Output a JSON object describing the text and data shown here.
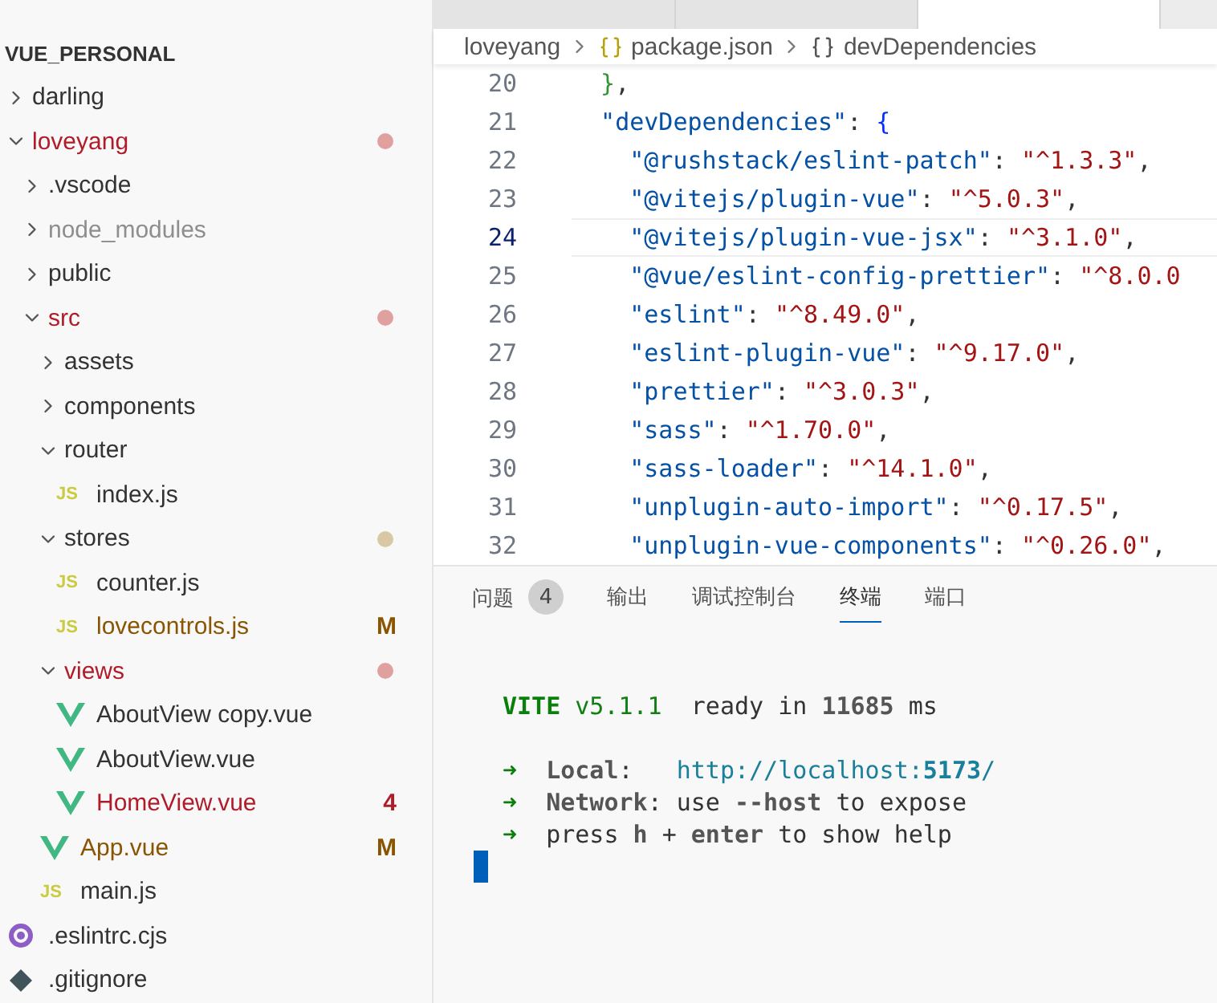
{
  "explorer": {
    "root": "VUE_PERSONAL",
    "items": [
      {
        "kind": "folder",
        "name": "darling",
        "expanded": false,
        "error": false,
        "modified": false,
        "ignored": false
      },
      {
        "kind": "folder",
        "name": "loveyang",
        "expanded": true,
        "error": true,
        "modified": false,
        "ignored": false,
        "color": "#e0a0a0",
        "children": [
          {
            "kind": "folder",
            "name": ".vscode",
            "expanded": false,
            "error": false,
            "modified": false,
            "ignored": false
          },
          {
            "kind": "folder",
            "name": "node_modules",
            "expanded": false,
            "error": false,
            "modified": false,
            "ignored": true
          },
          {
            "kind": "folder",
            "name": "public",
            "expanded": false,
            "error": false,
            "modified": false,
            "ignored": false
          },
          {
            "kind": "folder",
            "name": "src",
            "expanded": true,
            "error": true,
            "modified": false,
            "ignored": false,
            "color": "#e0a0a0",
            "children": [
              {
                "kind": "folder",
                "name": "assets",
                "expanded": false,
                "error": false,
                "modified": false,
                "ignored": false
              },
              {
                "kind": "folder",
                "name": "components",
                "expanded": false,
                "error": false,
                "modified": false,
                "ignored": false
              },
              {
                "kind": "folder",
                "name": "router",
                "expanded": true,
                "error": false,
                "modified": false,
                "ignored": false,
                "children": [
                  {
                    "kind": "js",
                    "icon_label": "JS",
                    "name": "index.js",
                    "error": false,
                    "modified": false,
                    "ignored": false
                  }
                ]
              },
              {
                "kind": "folder",
                "name": "stores",
                "expanded": true,
                "error": false,
                "modified": false,
                "ignored": false,
                "color": "#d8c8a8",
                "children": [
                  {
                    "kind": "js",
                    "icon_label": "JS",
                    "name": "counter.js",
                    "error": false,
                    "modified": false,
                    "ignored": false
                  },
                  {
                    "kind": "js",
                    "icon_label": "JS",
                    "name": "lovecontrols.js",
                    "error": false,
                    "modified": true,
                    "ignored": false,
                    "badge": "M"
                  }
                ]
              },
              {
                "kind": "folder",
                "name": "views",
                "expanded": true,
                "error": true,
                "modified": false,
                "ignored": false,
                "color": "#e0a0a0",
                "children": [
                  {
                    "kind": "vue",
                    "name": "AboutView copy.vue",
                    "error": false,
                    "modified": false,
                    "ignored": false
                  },
                  {
                    "kind": "vue",
                    "name": "AboutView.vue",
                    "error": false,
                    "modified": false,
                    "ignored": false
                  },
                  {
                    "kind": "vue",
                    "name": "HomeView.vue",
                    "error": true,
                    "modified": false,
                    "ignored": false,
                    "badge": "4"
                  }
                ]
              },
              {
                "kind": "vue",
                "name": "App.vue",
                "error": false,
                "modified": true,
                "ignored": false,
                "badge": "M"
              },
              {
                "kind": "js",
                "icon_label": "JS",
                "name": "main.js",
                "error": false,
                "modified": false,
                "ignored": false
              }
            ]
          }
        ]
      },
      {
        "kind": "eslint",
        "name": ".eslintrc.cjs",
        "error": false,
        "modified": false,
        "ignored": false
      },
      {
        "kind": "git",
        "name": ".gitignore",
        "error": false,
        "modified": false,
        "ignored": false
      }
    ]
  },
  "editor": {
    "open_tabs": [
      {
        "selected": false
      },
      {
        "selected": false
      },
      {
        "selected": true
      }
    ],
    "breadcrumb": [
      {
        "kind": "folder",
        "label": "loveyang"
      },
      {
        "kind": "json",
        "label": "package.json"
      },
      {
        "kind": "object",
        "label": "devDependencies"
      }
    ],
    "lines": [
      {
        "number": "20",
        "current": false,
        "tokens": [
          {
            "kind": "bracket2",
            "text": "  }"
          },
          {
            "kind": "punct",
            "text": ","
          }
        ]
      },
      {
        "number": "21",
        "current": false,
        "tokens": [
          {
            "kind": "key",
            "text": "  \"devDependencies\""
          },
          {
            "kind": "punct",
            "text": ": "
          },
          {
            "kind": "bracket1",
            "text": "{"
          }
        ]
      },
      {
        "number": "22",
        "current": false,
        "tokens": [
          {
            "kind": "key",
            "text": "    \"@rushstack/eslint-patch\""
          },
          {
            "kind": "punct",
            "text": ": "
          },
          {
            "kind": "string",
            "text": "\"^1.3.3\""
          },
          {
            "kind": "punct",
            "text": ","
          }
        ]
      },
      {
        "number": "23",
        "current": false,
        "tokens": [
          {
            "kind": "key",
            "text": "    \"@vitejs/plugin-vue\""
          },
          {
            "kind": "punct",
            "text": ": "
          },
          {
            "kind": "string",
            "text": "\"^5.0.3\""
          },
          {
            "kind": "punct",
            "text": ","
          }
        ]
      },
      {
        "number": "24",
        "current": true,
        "tokens": [
          {
            "kind": "key",
            "text": "    \"@vitejs/plugin-vue-jsx\""
          },
          {
            "kind": "punct",
            "text": ": "
          },
          {
            "kind": "string",
            "text": "\"^3.1.0\""
          },
          {
            "kind": "punct",
            "text": ","
          }
        ]
      },
      {
        "number": "25",
        "current": false,
        "tokens": [
          {
            "kind": "key",
            "text": "    \"@vue/eslint-config-prettier\""
          },
          {
            "kind": "punct",
            "text": ": "
          },
          {
            "kind": "string",
            "text": "\"^8.0.0"
          }
        ]
      },
      {
        "number": "26",
        "current": false,
        "tokens": [
          {
            "kind": "key",
            "text": "    \"eslint\""
          },
          {
            "kind": "punct",
            "text": ": "
          },
          {
            "kind": "string",
            "text": "\"^8.49.0\""
          },
          {
            "kind": "punct",
            "text": ","
          }
        ]
      },
      {
        "number": "27",
        "current": false,
        "tokens": [
          {
            "kind": "key",
            "text": "    \"eslint-plugin-vue\""
          },
          {
            "kind": "punct",
            "text": ": "
          },
          {
            "kind": "string",
            "text": "\"^9.17.0\""
          },
          {
            "kind": "punct",
            "text": ","
          }
        ]
      },
      {
        "number": "28",
        "current": false,
        "tokens": [
          {
            "kind": "key",
            "text": "    \"prettier\""
          },
          {
            "kind": "punct",
            "text": ": "
          },
          {
            "kind": "string",
            "text": "\"^3.0.3\""
          },
          {
            "kind": "punct",
            "text": ","
          }
        ]
      },
      {
        "number": "29",
        "current": false,
        "tokens": [
          {
            "kind": "key",
            "text": "    \"sass\""
          },
          {
            "kind": "punct",
            "text": ": "
          },
          {
            "kind": "string",
            "text": "\"^1.70.0\""
          },
          {
            "kind": "punct",
            "text": ","
          }
        ]
      },
      {
        "number": "30",
        "current": false,
        "tokens": [
          {
            "kind": "key",
            "text": "    \"sass-loader\""
          },
          {
            "kind": "punct",
            "text": ": "
          },
          {
            "kind": "string",
            "text": "\"^14.1.0\""
          },
          {
            "kind": "punct",
            "text": ","
          }
        ]
      },
      {
        "number": "31",
        "current": false,
        "tokens": [
          {
            "kind": "key",
            "text": "    \"unplugin-auto-import\""
          },
          {
            "kind": "punct",
            "text": ": "
          },
          {
            "kind": "string",
            "text": "\"^0.17.5\""
          },
          {
            "kind": "punct",
            "text": ","
          }
        ]
      },
      {
        "number": "32",
        "current": false,
        "tokens": [
          {
            "kind": "key",
            "text": "    \"unplugin-vue-components\""
          },
          {
            "kind": "punct",
            "text": ": "
          },
          {
            "kind": "string",
            "text": "\"^0.26.0\""
          },
          {
            "kind": "punct",
            "text": ","
          }
        ]
      }
    ]
  },
  "panel": {
    "tabs": [
      {
        "label": "问题",
        "badge": "4",
        "selected": false
      },
      {
        "label": "输出",
        "selected": false
      },
      {
        "label": "调试控制台",
        "selected": false
      },
      {
        "label": "终端",
        "selected": true
      },
      {
        "label": "端口",
        "selected": false
      }
    ],
    "terminal": [
      {
        "kind": "blank"
      },
      {
        "kind": "text",
        "segments": [
          {
            "kind": "green-bold",
            "text": "VITE"
          },
          {
            "kind": "green",
            "text": " v5.1.1"
          },
          {
            "kind": "plain",
            "text": "  ready in "
          },
          {
            "kind": "bold",
            "text": "11685"
          },
          {
            "kind": "plain",
            "text": " ms"
          }
        ]
      },
      {
        "kind": "blank"
      },
      {
        "kind": "text",
        "segments": [
          {
            "kind": "green-bold",
            "text": "➜"
          },
          {
            "kind": "bold",
            "text": "  Local"
          },
          {
            "kind": "plain",
            "text": ":   "
          },
          {
            "kind": "link",
            "text": "http://localhost:"
          },
          {
            "kind": "link-bold",
            "text": "5173"
          },
          {
            "kind": "link",
            "text": "/"
          }
        ]
      },
      {
        "kind": "text",
        "segments": [
          {
            "kind": "green-bold",
            "text": "➜"
          },
          {
            "kind": "bold",
            "text": "  Network"
          },
          {
            "kind": "plain",
            "text": ": use "
          },
          {
            "kind": "bold",
            "text": "--host"
          },
          {
            "kind": "plain",
            "text": " to expose"
          }
        ]
      },
      {
        "kind": "text",
        "segments": [
          {
            "kind": "green-bold",
            "text": "➜"
          },
          {
            "kind": "plain",
            "text": "  press "
          },
          {
            "kind": "bold",
            "text": "h"
          },
          {
            "kind": "plain",
            "text": " + "
          },
          {
            "kind": "bold",
            "text": "enter"
          },
          {
            "kind": "plain",
            "text": " to show help"
          }
        ]
      },
      {
        "kind": "cursor"
      }
    ]
  }
}
